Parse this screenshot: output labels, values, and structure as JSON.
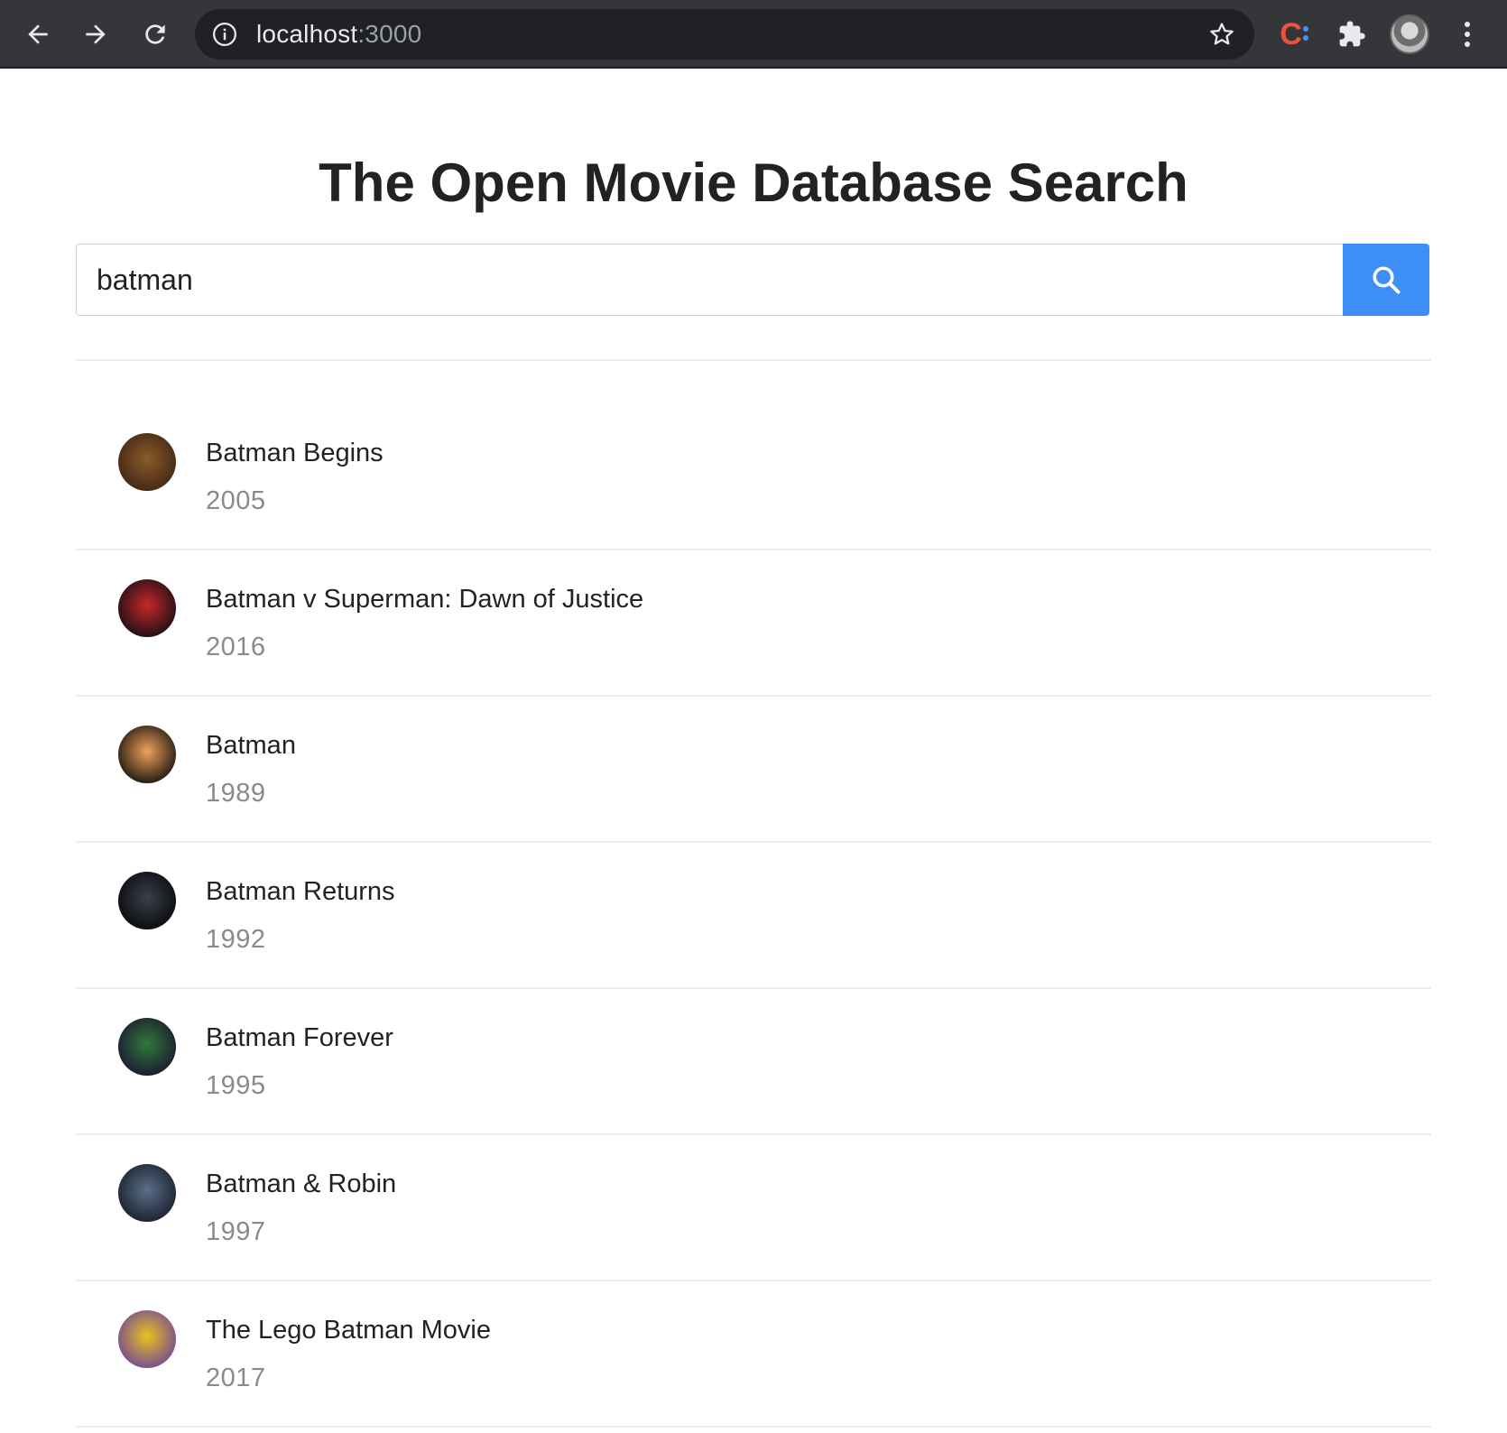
{
  "browser": {
    "url_host": "localhost",
    "url_port": ":3000"
  },
  "page": {
    "title": "The Open Movie Database Search"
  },
  "search": {
    "value": "batman"
  },
  "results": [
    {
      "title": "Batman Begins",
      "year": "2005",
      "poster_colors": [
        "#8a5a2b",
        "#3b2412"
      ]
    },
    {
      "title": "Batman v Superman: Dawn of Justice",
      "year": "2016",
      "poster_colors": [
        "#c62828",
        "#0d0d14"
      ]
    },
    {
      "title": "Batman",
      "year": "1989",
      "poster_colors": [
        "#f0a25a",
        "#0a0a0a"
      ]
    },
    {
      "title": "Batman Returns",
      "year": "1992",
      "poster_colors": [
        "#3a3f4a",
        "#050608"
      ]
    },
    {
      "title": "Batman Forever",
      "year": "1995",
      "poster_colors": [
        "#2f7a3a",
        "#1a1030"
      ]
    },
    {
      "title": "Batman & Robin",
      "year": "1997",
      "poster_colors": [
        "#5a6f8a",
        "#141a24"
      ]
    },
    {
      "title": "The Lego Batman Movie",
      "year": "2017",
      "poster_colors": [
        "#e8c21d",
        "#6a3fa0"
      ]
    }
  ]
}
